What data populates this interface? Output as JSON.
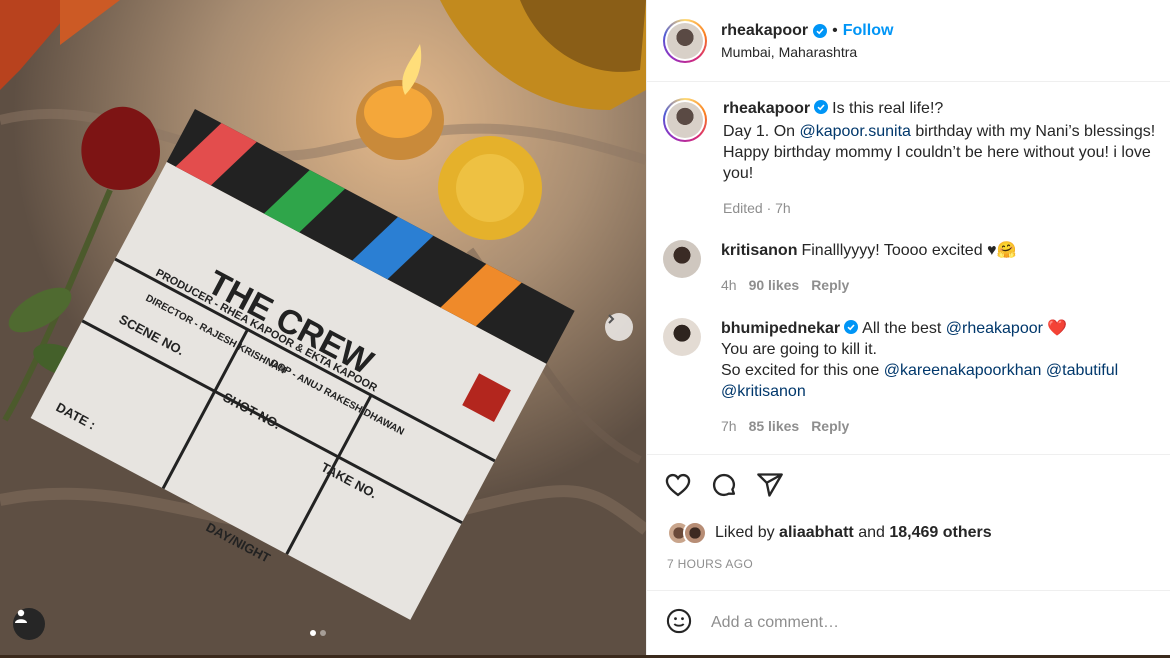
{
  "post": {
    "username": "rheakapoor",
    "separator": "•",
    "follow_label": "Follow",
    "location": "Mumbai, Maharashtra"
  },
  "caption": {
    "username": "rheakapoor",
    "line1": "Is this real life!?",
    "line2_prefix": "Day 1. On",
    "line2_mention": "@kapoor.sunita",
    "line2_suffix": "birthday with my Nani’s blessings! Happy birthday mommy I couldn’t be here without you! i love you!",
    "meta": "Edited · 7h"
  },
  "comments": [
    {
      "username": "kritisanon",
      "text": "Finalllyyyy! Toooo excited ♥🤗",
      "time": "4h",
      "likes": "90 likes",
      "reply": "Reply"
    },
    {
      "username": "bhumipednekar",
      "text_prefix": "All the best",
      "mention1": "@rheakapoor",
      "heart": "❤️",
      "line2": "You are going to kill it.",
      "line3_prefix": "So excited for this one",
      "mention2": "@kareenakapoorkhan",
      "mention3": "@tabutiful",
      "mention4": "@kritisanon",
      "time": "7h",
      "likes": "85 likes",
      "reply": "Reply"
    }
  ],
  "likes": {
    "prefix": "Liked by",
    "user": "aliaabhatt",
    "middle": "and",
    "others": "18,469 others"
  },
  "timestamp": "7 HOURS AGO",
  "add_comment": {
    "placeholder": "Add a comment…"
  },
  "clapper": {
    "title": "THE CREW",
    "producer": "PRODUCER - RHEA KAPOOR & EKTA KAPOOR",
    "director": "DIRECTOR - RAJESH KRISHNAN",
    "dop": "DOP - ANUJ RAKESH DHAWAN",
    "scene": "SCENE NO.",
    "shot": "SHOT NO.",
    "take": "TAKE NO.",
    "date": "DATE :",
    "daynight": "DAY/NIGHT"
  },
  "colors": {
    "accent": "#0095f6",
    "mention": "#00376b",
    "muted": "#8e8e8e",
    "heart": "#ed4956"
  },
  "icons": [
    "verified-badge-icon",
    "heart-icon",
    "comment-icon",
    "share-icon",
    "emoji-icon",
    "chevron-right-icon",
    "user-tag-icon"
  ]
}
